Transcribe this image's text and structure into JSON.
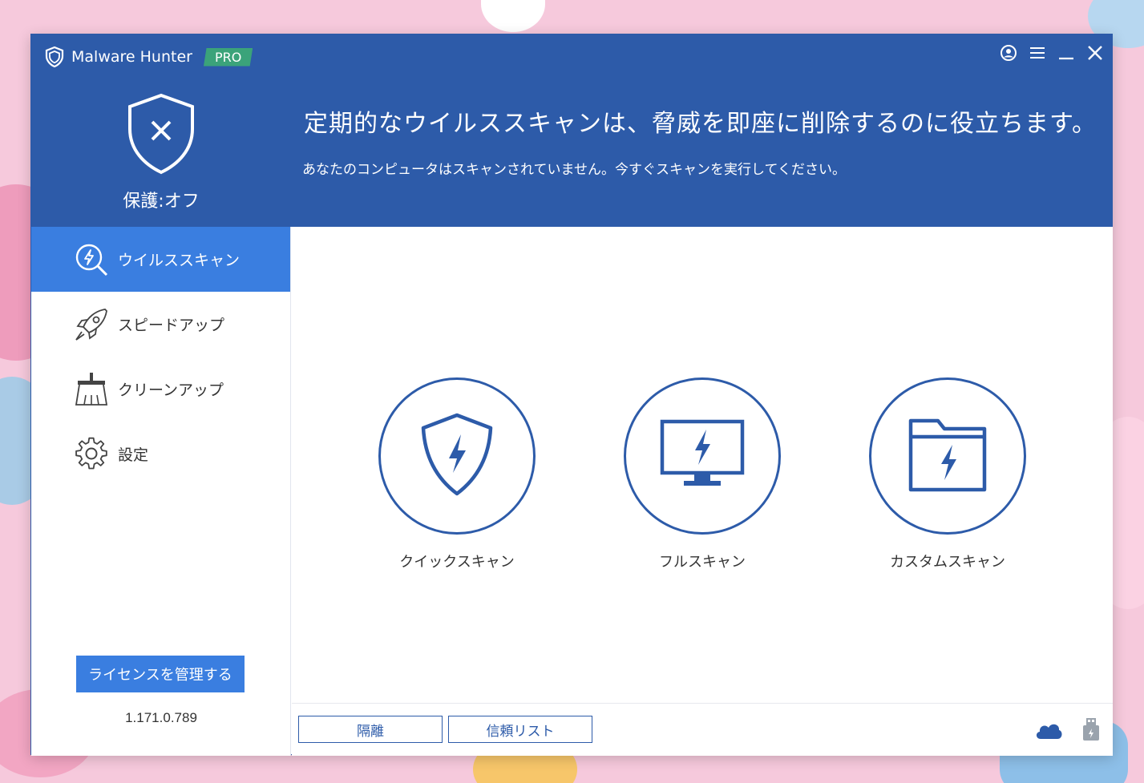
{
  "app": {
    "name": "Malware Hunter",
    "edition_badge": "PRO"
  },
  "window_controls": [
    "account-icon",
    "menu-icon",
    "minimize-icon",
    "close-icon"
  ],
  "status": {
    "label": "保護:オフ",
    "icon": "shield-x-icon"
  },
  "header": {
    "headline": "定期的なウイルススキャンは、脅威を即座に削除するのに役立ちます。",
    "subline": "あなたのコンピュータはスキャンされていません。今すぐスキャンを実行してください。"
  },
  "sidebar": {
    "items": [
      {
        "label": "ウイルススキャン",
        "icon": "scan-icon",
        "active": true
      },
      {
        "label": "スピードアップ",
        "icon": "rocket-icon",
        "active": false
      },
      {
        "label": "クリーンアップ",
        "icon": "broom-icon",
        "active": false
      },
      {
        "label": "設定",
        "icon": "gear-icon",
        "active": false
      }
    ],
    "license_button": "ライセンスを管理する",
    "version": "1.171.0.789"
  },
  "scan_options": [
    {
      "label": "クイックスキャン",
      "icon": "shield-bolt-icon"
    },
    {
      "label": "フルスキャン",
      "icon": "monitor-bolt-icon"
    },
    {
      "label": "カスタムスキャン",
      "icon": "folder-bolt-icon"
    }
  ],
  "footer": {
    "quarantine": "隔離",
    "trust_list": "信頼リスト",
    "icons": [
      "cloud-icon",
      "usb-icon"
    ]
  },
  "colors": {
    "brand_blue": "#2d5ba9",
    "active_blue": "#3a7ee0",
    "pro_green": "#3ba37a"
  }
}
